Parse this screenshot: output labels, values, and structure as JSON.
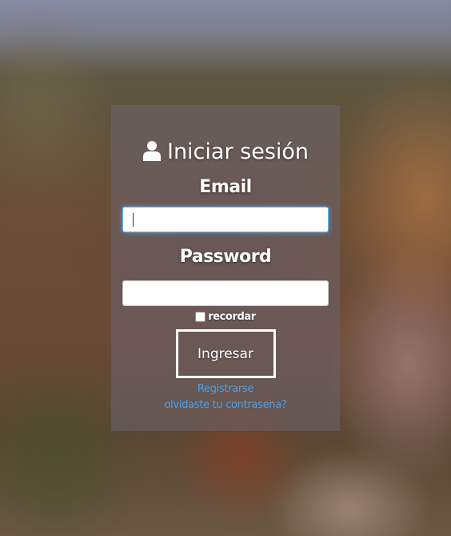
{
  "login": {
    "title": "Iniciar sesión",
    "icon": "user-icon",
    "email_label": "Email",
    "email_value": "",
    "password_label": "Password",
    "password_value": "",
    "remember_label": "recordar",
    "remember_checked": false,
    "submit_label": "Ingresar",
    "register_link": "Registrarse",
    "forgot_link": "olvidaste tu contrasena?"
  },
  "colors": {
    "link": "#4aa0e6",
    "focus": "#66afe9",
    "text": "#ffffff"
  }
}
